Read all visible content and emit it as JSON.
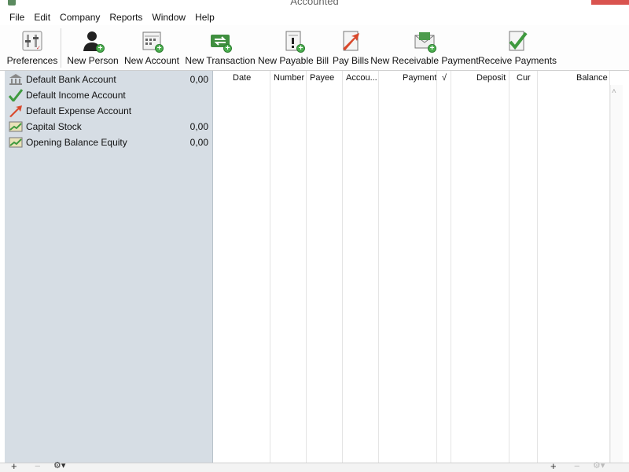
{
  "window": {
    "title": "Accounted"
  },
  "menu": [
    "File",
    "Edit",
    "Company",
    "Reports",
    "Window",
    "Help"
  ],
  "toolbar": {
    "preferences": "Preferences",
    "new_person": "New Person",
    "new_account": "New Account",
    "new_transaction": "New Transaction",
    "new_payable_bill": "New Payable Bill",
    "pay_bills": "Pay Bills",
    "new_receivable_payment": "New Receivable Payment",
    "receive_payments": "Receive Payments"
  },
  "accounts": [
    {
      "name": "Default Bank Account",
      "balance": "0,00",
      "icon": "bank-icon"
    },
    {
      "name": "Default Income Account",
      "balance": "",
      "icon": "income-check-icon"
    },
    {
      "name": "Default Expense Account",
      "balance": "",
      "icon": "expense-arrow-icon"
    },
    {
      "name": "Capital Stock",
      "balance": "0,00",
      "icon": "chart-icon"
    },
    {
      "name": "Opening Balance Equity",
      "balance": "0,00",
      "icon": "chart-icon"
    }
  ],
  "columns": {
    "date": "Date",
    "number": "Number",
    "payee": "Payee",
    "account": "Accou...",
    "payment": "Payment",
    "check": "√",
    "deposit": "Deposit",
    "currency": "Cur",
    "balance": "Balance"
  },
  "bottom": {
    "add": "+",
    "remove": "−",
    "gear": "⚙▾"
  },
  "colors": {
    "sidebar_bg": "#d6dde4",
    "accent_green": "#4caf50",
    "close_red": "#d9534f"
  }
}
